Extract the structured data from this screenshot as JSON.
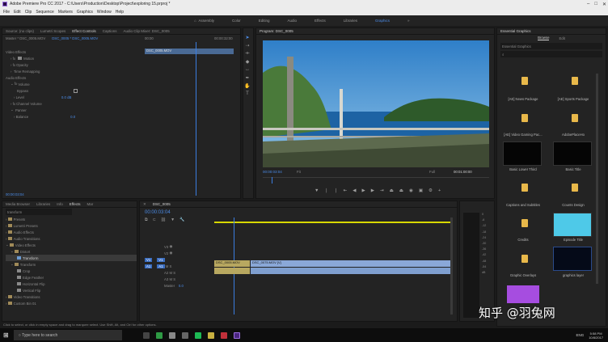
{
  "app": {
    "title": "Adobe Premiere Pro CC 2017 - C:\\Users\\Production\\Desktop\\Project\\exploring 15.prproj *"
  },
  "menu": [
    "File",
    "Edit",
    "Clip",
    "Sequence",
    "Markers",
    "Graphics",
    "Window",
    "Help"
  ],
  "workspaces": [
    "Assembly",
    "Color",
    "Editing",
    "Audio",
    "Effects",
    "Libraries",
    "Graphics"
  ],
  "workspace_active": "Graphics",
  "source_tabs": [
    "Source: (no clips)",
    "Lumetri Scopes",
    "Effect Controls",
    "Captions",
    "Audio Clip Mixer: DSC_0005"
  ],
  "ec": {
    "master": "Master * DSC_0005.MOV",
    "seq_clip": "DSC_0005 * DSC_0005.MOV",
    "tc_start": "00:00",
    "tc_end": "00:00:32:00",
    "clip_label": "DSC_0005.MOV",
    "video_effects": "Video Effects",
    "motion": "Motion",
    "opacity": "Opacity",
    "time_remap": "Time Remapping",
    "audio_effects": "Audio Effects",
    "volume": "Volume",
    "bypass": "Bypass",
    "level": "Level",
    "level_val": "0.0 dB",
    "channel_vol": "Channel Volume",
    "panner": "Panner",
    "balance": "Balance",
    "balance_val": "0.0",
    "timecode": "00:00:03:04"
  },
  "program": {
    "title": "Program: DSC_0005",
    "timecode": "00:00:03:04",
    "fit": "Fit",
    "quality": "Full",
    "duration": "00:01:00:00"
  },
  "eg": {
    "title": "Essential Graphics",
    "tabs": [
      "Browse",
      "Edit"
    ],
    "dropdown": "Essential Graphics",
    "items": [
      "[AE] News Package",
      "[AE] Sports Package",
      "[AE] Video Gaming Pac...",
      "AdobePlaceHo",
      "Basic Lower Third",
      "Basic Title",
      "Captions and Subtitles",
      "Counts Design",
      "Credits",
      "Episode Title",
      "Graphic Overlays",
      "graphics layer"
    ]
  },
  "effects": {
    "tabs": [
      "Media Browser",
      "Libraries",
      "Info",
      "Effects",
      "Mar"
    ],
    "search": "transform",
    "tree": [
      "Presets",
      "Lumetri Presets",
      "Audio Effects",
      "Audio Transitions",
      "Video Effects",
      "Distort",
      "Transform",
      "Transform",
      "Crop",
      "Edge Feather",
      "Horizontal Flip",
      "Vertical Flip",
      "Video Transitions",
      "Custom Bin 01"
    ]
  },
  "timeline": {
    "tab": "DSC_0005",
    "timecode": "00:00:03:04",
    "tracks": [
      "V3",
      "V2",
      "V1",
      "A1",
      "A2",
      "A3",
      "Master"
    ],
    "master_val": "0.0",
    "clip1": "DSC_0005.MOV",
    "clip2": "DSC_0075.MOV [V]"
  },
  "meter": [
    "0",
    "-6",
    "-12",
    "-18",
    "-24",
    "-30",
    "-36",
    "-42",
    "-48",
    "-54",
    "dB"
  ],
  "status": "Click to select, or click in empty space and drag to marquee select. Use Shift, Alt, and Ctrl for other options.",
  "taskbar": {
    "search": "Type here to search",
    "lang": "ENG",
    "time": "5:58 PM",
    "date": "10/8/2017"
  },
  "watermark": "知乎 @羽兔网"
}
